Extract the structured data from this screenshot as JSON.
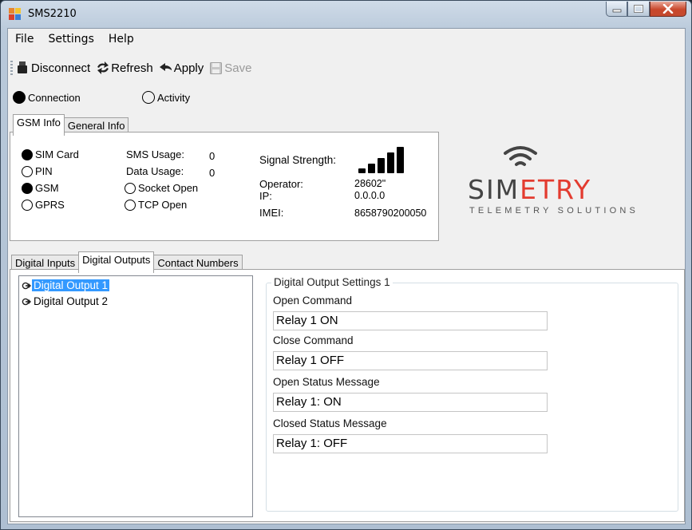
{
  "window": {
    "title": "SMS2210"
  },
  "menu": {
    "items": [
      "File",
      "Settings",
      "Help"
    ]
  },
  "toolbar": {
    "disconnect": "Disconnect",
    "refresh": "Refresh",
    "apply": "Apply",
    "save": "Save"
  },
  "status": {
    "connection": {
      "label": "Connection",
      "on": true
    },
    "activity": {
      "label": "Activity",
      "on": false
    }
  },
  "top_tabs": [
    {
      "label": "GSM Info",
      "active": true
    },
    {
      "label": "General Info",
      "active": false
    }
  ],
  "gsm": {
    "indicators": [
      {
        "label": "SIM Card",
        "on": true
      },
      {
        "label": "PIN",
        "on": false
      },
      {
        "label": "GSM",
        "on": true
      },
      {
        "label": "GPRS",
        "on": false
      }
    ],
    "sms_usage_label": "SMS Usage:",
    "sms_usage_value": "0",
    "data_usage_label": "Data Usage:",
    "data_usage_value": "0",
    "socket_open": {
      "label": "Socket Open",
      "on": false
    },
    "tcp_open": {
      "label": "TCP Open",
      "on": false
    },
    "signal_label": "Signal Strength:",
    "signal_bars": 5,
    "operator_label": "Operator:",
    "operator_value": "28602\"",
    "ip_label": "IP:",
    "ip_value": "0.0.0.0",
    "imei_label": "IMEI:",
    "imei_value": "8658790200050"
  },
  "logo": {
    "text_left": "SIM",
    "text_right": "ETRY",
    "tagline": "TELEMETRY SOLUTIONS",
    "accent": "#e33b2f"
  },
  "bottom_tabs": [
    {
      "label": "Digital Inputs",
      "active": false
    },
    {
      "label": "Digital Outputs",
      "active": true
    },
    {
      "label": "Contact Numbers",
      "active": false
    }
  ],
  "outputs": {
    "items": [
      {
        "label": "Digital Output 1",
        "selected": true
      },
      {
        "label": "Digital Output 2",
        "selected": false
      }
    ],
    "settings_title": "Digital Output Settings 1",
    "open_command_label": "Open Command",
    "open_command_value": "Relay 1 ON",
    "close_command_label": "Close Command",
    "close_command_value": "Relay 1 OFF",
    "open_status_label": "Open Status Message",
    "open_status_value": "Relay 1: ON",
    "closed_status_label": "Closed Status Message",
    "closed_status_value": "Relay 1: OFF"
  }
}
